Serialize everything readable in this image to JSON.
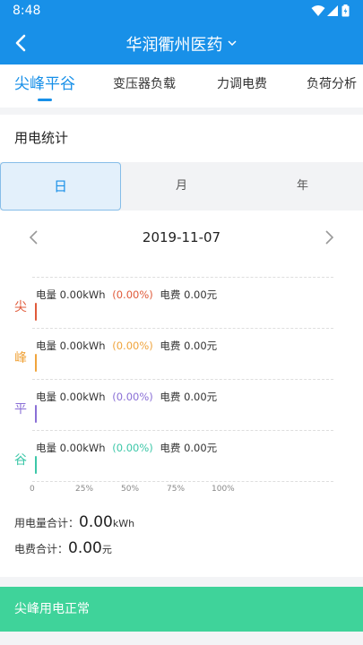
{
  "status_bar": {
    "time": "8:48"
  },
  "header": {
    "title": "华润衢州医药"
  },
  "tabs": [
    {
      "label": "尖峰平谷",
      "active": true
    },
    {
      "label": "变压器负载"
    },
    {
      "label": "力调电费"
    },
    {
      "label": "负荷分析"
    }
  ],
  "section": {
    "title": "用电统计"
  },
  "period": {
    "options": [
      "日",
      "月",
      "年"
    ],
    "selected": "日"
  },
  "date": {
    "value": "2019-11-07"
  },
  "chart_data": {
    "type": "bar",
    "orientation": "horizontal",
    "categories": [
      "尖",
      "峰",
      "平",
      "谷"
    ],
    "values": [
      0,
      0,
      0,
      0
    ],
    "xlim": [
      0,
      100
    ],
    "xticks": [
      "0",
      "25%",
      "50%",
      "75%",
      "100%"
    ],
    "rows": [
      {
        "label": "尖",
        "energy_label": "电量",
        "energy": "0.00kWh",
        "pct": "(0.00%)",
        "cost_label": "电费",
        "cost": "0.00元",
        "color": "#e05a3a"
      },
      {
        "label": "峰",
        "energy_label": "电量",
        "energy": "0.00kWh",
        "pct": "(0.00%)",
        "cost_label": "电费",
        "cost": "0.00元",
        "color": "#f0a43c"
      },
      {
        "label": "平",
        "energy_label": "电量",
        "energy": "0.00kWh",
        "pct": "(0.00%)",
        "cost_label": "电费",
        "cost": "0.00元",
        "color": "#8a6fd6"
      },
      {
        "label": "谷",
        "energy_label": "电量",
        "energy": "0.00kWh",
        "pct": "(0.00%)",
        "cost_label": "电费",
        "cost": "0.00元",
        "color": "#3cc7a8"
      }
    ]
  },
  "totals": {
    "energy_label": "用电量合计：",
    "energy_value": "0.00",
    "energy_unit": "kWh",
    "cost_label": "电费合计：",
    "cost_value": "0.00",
    "cost_unit": "元"
  },
  "banner": {
    "text": "尖峰用电正常",
    "color": "#3fd39a"
  },
  "colors": {
    "primary": "#1890e8"
  }
}
